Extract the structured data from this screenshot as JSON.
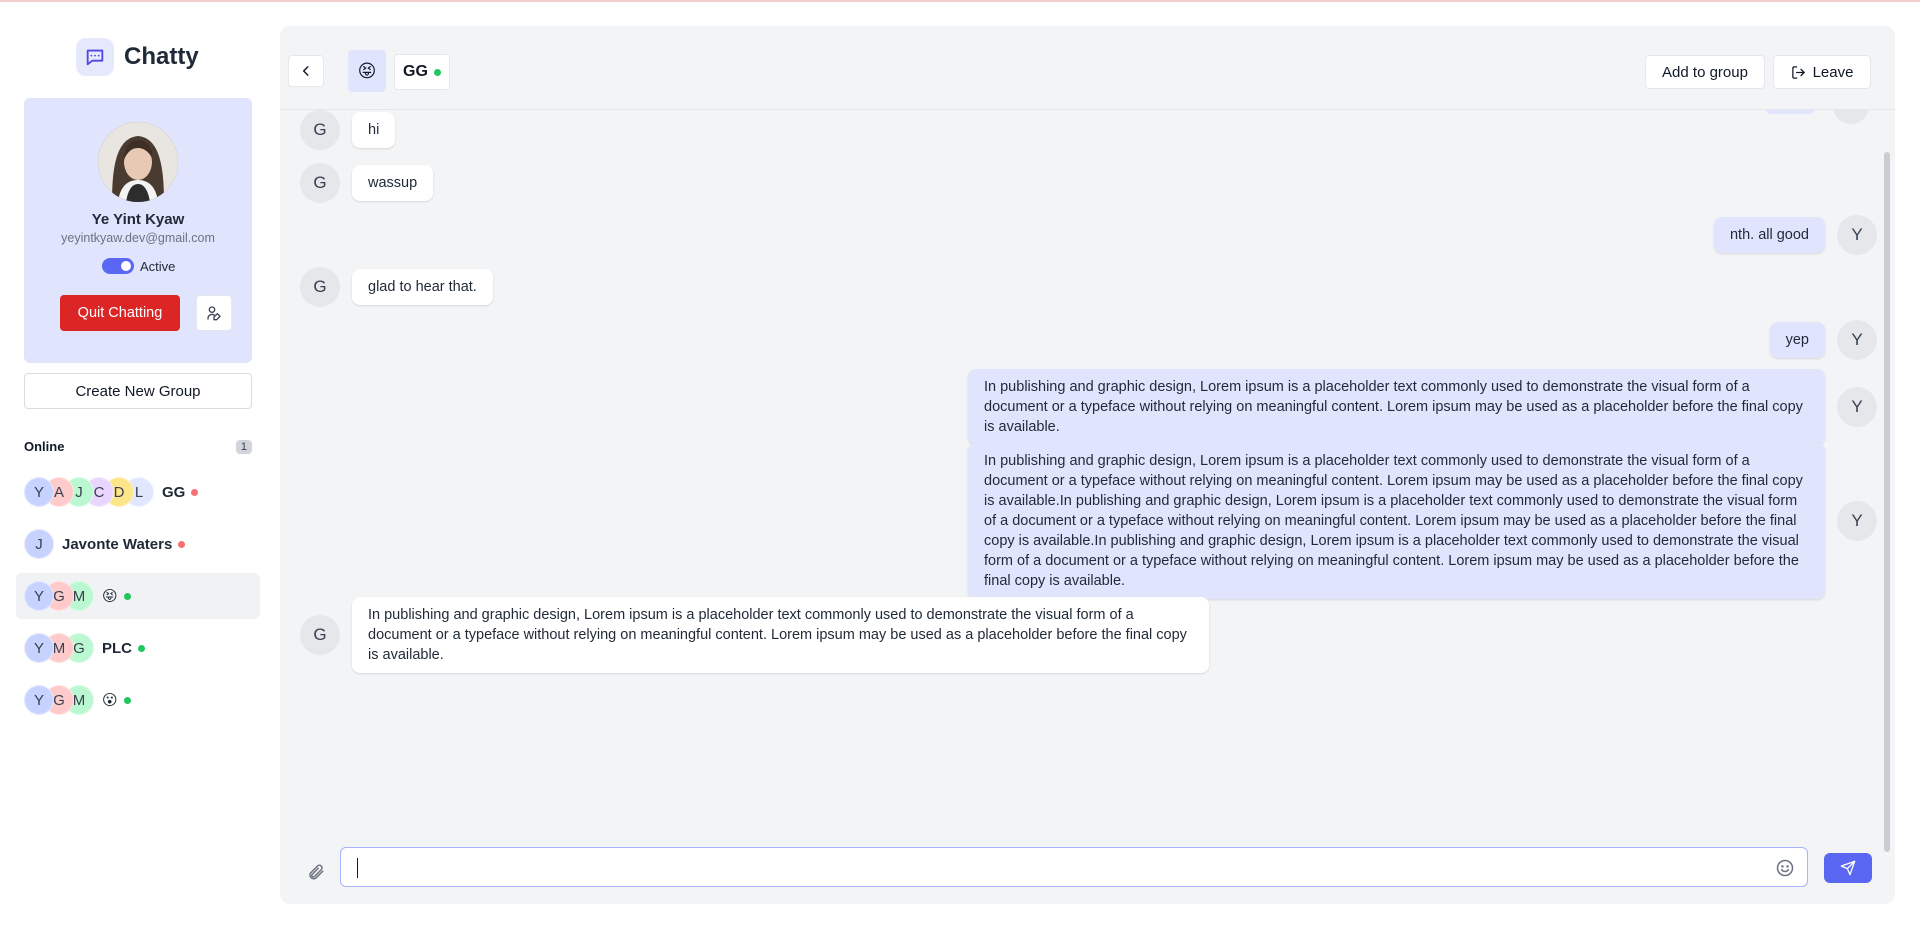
{
  "app": {
    "name": "Chatty"
  },
  "profile": {
    "name": "Ye Yint Kyaw",
    "email": "yeyintkyaw.dev@gmail.com",
    "status": "Active",
    "quit_label": "Quit Chatting"
  },
  "sidebar": {
    "create_group_label": "Create New Group",
    "online_label": "Online",
    "online_count": "1",
    "chats": [
      {
        "avatars": [
          "Y",
          "A",
          "J",
          "C",
          "D",
          "L"
        ],
        "name": "GG",
        "status_color": "#f87171",
        "active": false
      },
      {
        "avatars": [
          "J"
        ],
        "name": "Javonte Waters",
        "status_color": "#f87171",
        "active": false
      },
      {
        "avatars": [
          "Y",
          "G",
          "M"
        ],
        "name": "😝",
        "status_color": "#22c55e",
        "active": true
      },
      {
        "avatars": [
          "Y",
          "M",
          "G"
        ],
        "name": "PLC",
        "status_color": "#22c55e",
        "active": false
      },
      {
        "avatars": [
          "Y",
          "G",
          "M"
        ],
        "name": "😮",
        "status_color": "#22c55e",
        "active": false
      }
    ]
  },
  "chat_header": {
    "emoji": "😝",
    "title": "GG",
    "add_label": "Add to group",
    "leave_label": "Leave"
  },
  "messages": [
    {
      "sender": "G",
      "side": "left",
      "text": "hi"
    },
    {
      "sender": "G",
      "side": "left",
      "text": "wassup"
    },
    {
      "sender": "Y",
      "side": "right",
      "text": "nth. all good"
    },
    {
      "sender": "G",
      "side": "left",
      "text": "glad to hear that."
    },
    {
      "sender": "Y",
      "side": "right",
      "text": "yep"
    },
    {
      "sender": "Y",
      "side": "right",
      "text": "In publishing and graphic design, Lorem ipsum is a placeholder text commonly used to demonstrate the visual form of a document or a typeface without relying on meaningful content. Lorem ipsum may be used as a placeholder before the final copy is available."
    },
    {
      "sender": "Y",
      "side": "right",
      "text": "In publishing and graphic design, Lorem ipsum is a placeholder text commonly used to demonstrate the visual form of a document or a typeface without relying on meaningful content. Lorem ipsum may be used as a placeholder before the final copy is available.In publishing and graphic design, Lorem ipsum is a placeholder text commonly used to demonstrate the visual form of a document or a typeface without relying on meaningful content. Lorem ipsum may be used as a placeholder before the final copy is available.In publishing and graphic design, Lorem ipsum is a placeholder text commonly used to demonstrate the visual form of a document or a typeface without relying on meaningful content. Lorem ipsum may be used as a placeholder before the final copy is available."
    },
    {
      "sender": "G",
      "side": "left",
      "text": "In publishing and graphic design, Lorem ipsum is a placeholder text commonly used to demonstrate the visual form of a document or a typeface without relying on meaningful content. Lorem ipsum may be used as a placeholder before the final copy is available."
    }
  ],
  "composer": {
    "value": "",
    "placeholder": ""
  },
  "colors": {
    "accent": "#5a67f2",
    "danger": "#dc2626",
    "bubble_out": "#e0e5fd",
    "online": "#22c55e",
    "offline": "#f87171"
  }
}
